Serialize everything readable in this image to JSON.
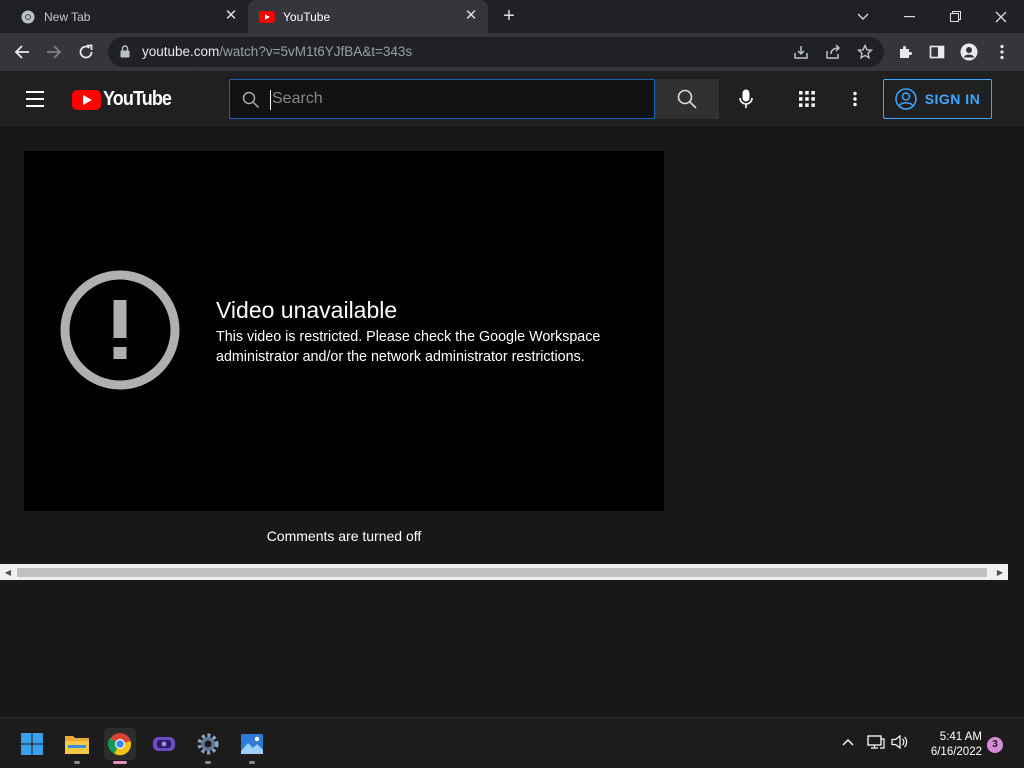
{
  "browser": {
    "tabs": [
      {
        "title": "New Tab",
        "active": false
      },
      {
        "title": "YouTube",
        "active": true
      }
    ],
    "address": {
      "domain": "youtube.com",
      "path": "/watch?v=5vM1t6YJfBA&t=343s"
    }
  },
  "youtube": {
    "logo_text": "YouTube",
    "search_placeholder": "Search",
    "sign_in_label": "SIGN IN"
  },
  "player": {
    "error_title": "Video unavailable",
    "error_message": "This video is restricted. Please check the Google Workspace administrator and/or the network administrator restrictions."
  },
  "comments_status": "Comments are turned off",
  "taskbar": {
    "time": "5:41 AM",
    "date": "6/16/2022",
    "notification_count": "3"
  },
  "colors": {
    "accent_blue": "#3ea6ff",
    "youtube_red": "#ff0000",
    "page_bg": "#181818",
    "header_bg": "#202020"
  }
}
